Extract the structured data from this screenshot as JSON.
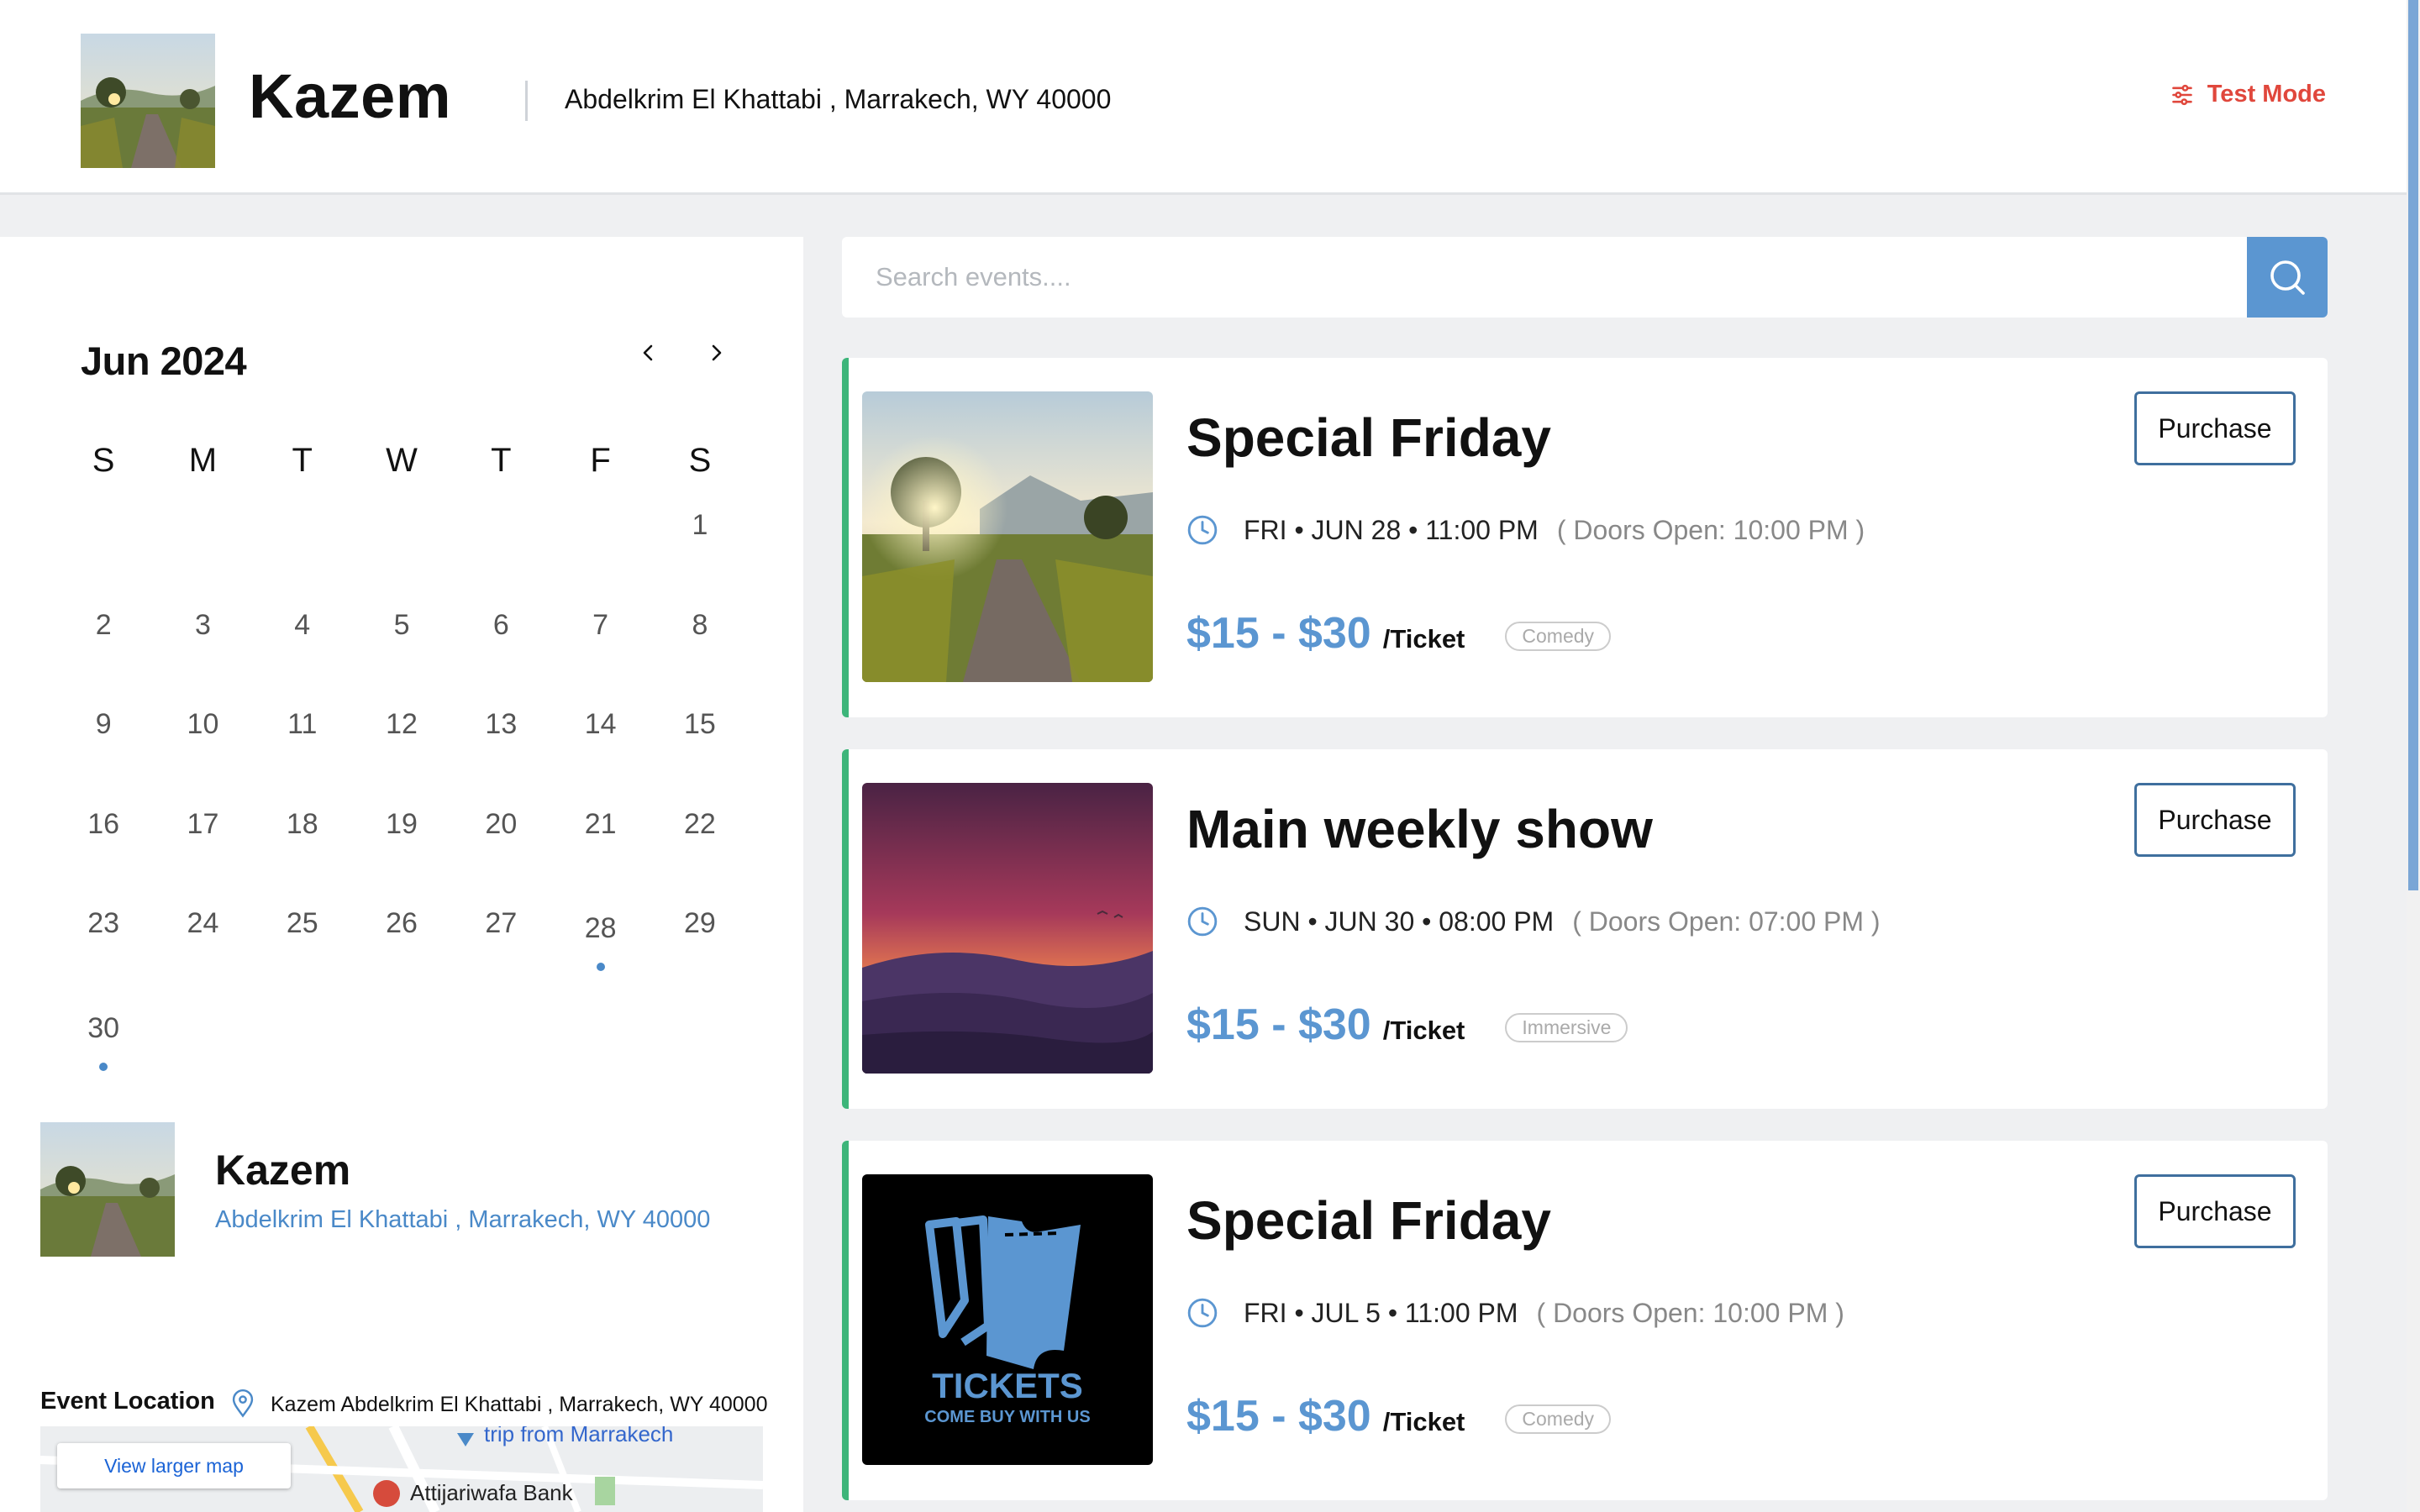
{
  "header": {
    "brand": "Kazem",
    "address": "Abdelkrim El Khattabi , Marrakech, WY 40000",
    "test_mode": "Test Mode",
    "logo_icon": "sliders-icon"
  },
  "calendar": {
    "month": "Jun 2024",
    "weekdays": [
      "S",
      "M",
      "T",
      "W",
      "T",
      "F",
      "S"
    ],
    "leading_blanks": 6,
    "days": 30,
    "event_days": [
      28,
      30
    ],
    "prev_icon": "chevron-left-icon",
    "next_icon": "chevron-right-icon"
  },
  "venue": {
    "name": "Kazem",
    "address": "Abdelkrim El Khattabi , Marrakech, WY 40000"
  },
  "location": {
    "label": "Event Location",
    "text": "Kazem Abdelkrim El Khattabi , Marrakech, WY 40000",
    "map_button": "View larger map",
    "map_label_1": "trip from Marrakech",
    "map_label_2": "Attijariwafa Bank"
  },
  "search": {
    "placeholder": "Search events...."
  },
  "events": [
    {
      "title": "Special Friday",
      "when": "FRI • JUN 28 • 11:00 PM",
      "doors": "( Doors Open: 10:00 PM )",
      "price": "$15 - $30",
      "per": "/Ticket",
      "tag": "Comedy",
      "button": "Purchase",
      "image": "meadow-sunrise"
    },
    {
      "title": "Main weekly show",
      "when": "SUN • JUN 30 • 08:00 PM",
      "doors": "( Doors Open: 07:00 PM )",
      "price": "$15 - $30",
      "per": "/Ticket",
      "tag": "Immersive",
      "button": "Purchase",
      "image": "purple-sunset"
    },
    {
      "title": "Special Friday",
      "when": "FRI • JUL 5 • 11:00 PM",
      "doors": "( Doors Open: 10:00 PM )",
      "price": "$15 - $30",
      "per": "/Ticket",
      "tag": "Comedy",
      "button": "Purchase",
      "image": "tickets-logo",
      "image_text_1": "TICKETS",
      "image_text_2": "COME BUY WITH US"
    }
  ],
  "colors": {
    "accent": "#5b96d1",
    "card_border": "#3db57a",
    "test_mode": "#e0473c"
  }
}
